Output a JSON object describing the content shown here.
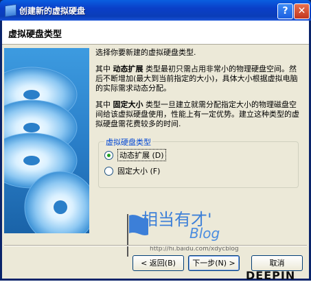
{
  "window": {
    "title": "创建新的虚拟硬盘",
    "help_label": "?",
    "close_label": "✕"
  },
  "header": {
    "title": "虚拟硬盘类型"
  },
  "body": {
    "intro": "选择你要新建的虚拟硬盘类型.",
    "dynamic_prefix": "其中",
    "dynamic_term": "动态扩展",
    "dynamic_desc": "类型最初只需占用非常小的物理硬盘空间。然后不断增加(最大到当前指定的大小)，具体大小根据虚拟电脑的实际需求动态分配。",
    "fixed_prefix": "其中",
    "fixed_term": "固定大小",
    "fixed_desc": "类型一旦建立就需分配指定大小的物理磁盘空间给该虚拟硬盘使用，性能上有一定优势。建立这种类型的虚拟硬盘需花费较多的时间."
  },
  "group": {
    "legend": "虚拟硬盘类型",
    "options": [
      {
        "label": "动态扩展 (D)",
        "checked": true
      },
      {
        "label": "固定大小 (F)",
        "checked": false
      }
    ]
  },
  "buttons": {
    "back": "< 返回(B)",
    "next": "下一步(N) >",
    "cancel": "取消"
  },
  "watermark": {
    "title": "相当有才'",
    "blog": "Blog",
    "url": "http://hi.baidu.com/xdycblog"
  },
  "brand": "DEEPIN"
}
